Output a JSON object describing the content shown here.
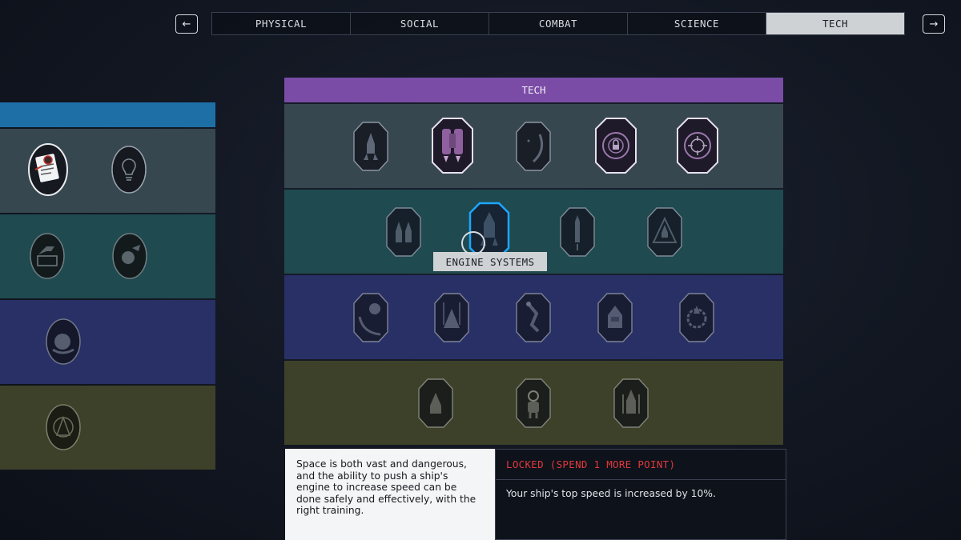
{
  "nav": {
    "prev_icon": "←",
    "next_icon": "→",
    "tabs": [
      {
        "label": "PHYSICAL",
        "active": false
      },
      {
        "label": "SOCIAL",
        "active": false
      },
      {
        "label": "COMBAT",
        "active": false
      },
      {
        "label": "SCIENCE",
        "active": false
      },
      {
        "label": "TECH",
        "active": true
      }
    ]
  },
  "panel": {
    "title": "TECH"
  },
  "skills": {
    "left_column": [
      {
        "row": 1,
        "icons": [
          "document-bug-icon",
          "lightbulb-icon"
        ],
        "unlocked": true
      },
      {
        "row": 2,
        "icons": [
          "weapon-crate-icon",
          "planet-claw-icon"
        ],
        "unlocked": false
      },
      {
        "row": 3,
        "icons": [
          "planet-hand-icon"
        ],
        "unlocked": false
      },
      {
        "row": 4,
        "icons": [
          "compass-icon"
        ],
        "unlocked": false
      }
    ],
    "tier_1": [
      "rocket-launch-icon",
      "jetpack-icon",
      "planet-arc-icon",
      "lock-target-icon",
      "targeting-crosshair-icon"
    ],
    "tier_2": [
      "twin-rockets-icon",
      "engine-systems-icon",
      "missile-icon",
      "ship-emblem-icon"
    ],
    "tier_3": [
      "planet-orbit-icon",
      "ship-nose-icon",
      "robot-arm-icon",
      "cockpit-icon",
      "ship-gear-icon"
    ],
    "tier_4": [
      "shuttle-icon",
      "astronaut-icon",
      "rocket-stack-icon"
    ]
  },
  "tooltip": {
    "label": "ENGINE SYSTEMS"
  },
  "detail": {
    "description": "Space is both vast and dangerous, and the ability to push a ship's engine to increase speed can be done safely and effectively, with the right training.",
    "status": "LOCKED (SPEND 1 MORE POINT)",
    "effect": "Your ship's top speed is increased by 10%."
  },
  "colors": {
    "tech_header": "#7a4ca6",
    "left_header": "#1f6fa7",
    "tier_1": "#37474f",
    "tier_2": "#1f4a4f",
    "tier_3": "#283066",
    "tier_4": "#3e4129",
    "locked_text": "#e0393b",
    "selected_outline": "#1ea6ff"
  }
}
